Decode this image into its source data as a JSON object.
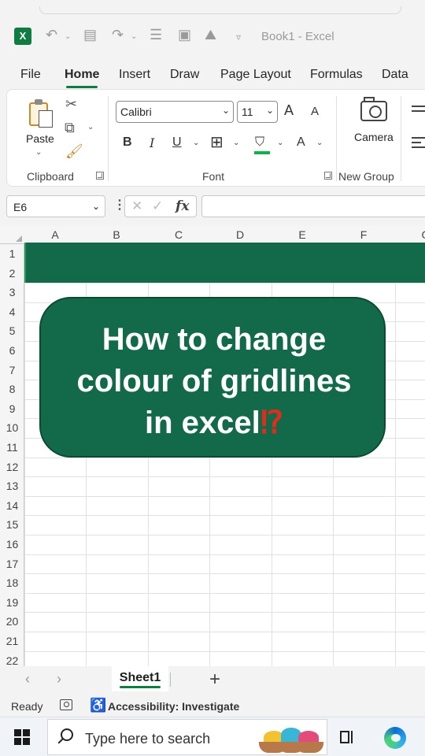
{
  "app": {
    "logo": "X",
    "title": "Book1  -  Excel"
  },
  "menu": {
    "tabs": [
      "File",
      "Home",
      "Insert",
      "Draw",
      "Page Layout",
      "Formulas",
      "Data"
    ],
    "active": "Home"
  },
  "ribbon": {
    "clipboard": {
      "paste_label": "Paste",
      "group_label": "Clipboard"
    },
    "font": {
      "family": "Calibri",
      "size": "11",
      "grow": "A",
      "shrink": "A",
      "bold": "B",
      "italic": "I",
      "underline": "U",
      "font_color": "A",
      "group_label": "Font"
    },
    "new_group": {
      "camera_label": "Camera",
      "group_label": "New Group"
    }
  },
  "formula_bar": {
    "name_box": "E6",
    "fx": "fx",
    "cancel": "✕",
    "enter": "✓",
    "value": ""
  },
  "grid": {
    "columns": [
      "A",
      "B",
      "C",
      "D",
      "E",
      "F",
      "G"
    ],
    "rows": [
      "1",
      "2",
      "3",
      "4",
      "5",
      "6",
      "7",
      "8",
      "9",
      "10",
      "11",
      "12",
      "13",
      "14",
      "15",
      "16",
      "17",
      "18",
      "19",
      "20",
      "21",
      "22"
    ]
  },
  "overlay": {
    "line1": "How to change",
    "line2": "colour of gridlines",
    "line3": "in excel",
    "mark": "⁉",
    "card_color": "#136a4a"
  },
  "sheets": {
    "tabs": [
      "Sheet1"
    ],
    "add": "+"
  },
  "status": {
    "ready": "Ready",
    "accessibility": "Accessibility: Investigate"
  },
  "taskbar": {
    "search_placeholder": "Type here to search"
  },
  "colors": {
    "accent": "#107c41",
    "band": "#136a4a",
    "mark": "#e02b1d"
  }
}
